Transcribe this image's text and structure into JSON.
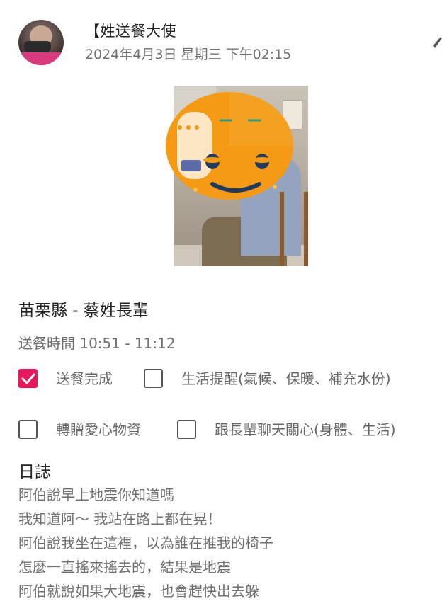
{
  "post": {
    "author_name": "【姓送餐大使",
    "timestamp": "2024年4月3日 星期三 下午02:15"
  },
  "record": {
    "location": "苗栗縣 - 蔡姓長輩",
    "delivery_time": "送餐時間 10:51 - 11:12"
  },
  "tasks": [
    {
      "label": "送餐完成",
      "checked": true
    },
    {
      "label": "生活提醒(氣候、保暖、補充水份)",
      "checked": false
    },
    {
      "label": "轉贈愛心物資",
      "checked": false
    },
    {
      "label": "跟長輩聊天關心(身體、生活)",
      "checked": false
    }
  ],
  "log": {
    "title": "日誌",
    "lines": [
      "阿伯說早上地震你知道嗎",
      "我知道阿～ 我站在路上都在晃！",
      "阿伯說我坐在這裡，以為誰在推我的椅子",
      "怎麼一直搖來搖去的，結果是地震",
      "阿伯就說如果大地震，也會趕快出去躲"
    ]
  },
  "colors": {
    "accent": "#e8185a",
    "text_primary": "#222222",
    "text_secondary": "#6f6f6f"
  },
  "icons": {
    "checkmark": "check-icon",
    "edit": "pencil-icon"
  }
}
